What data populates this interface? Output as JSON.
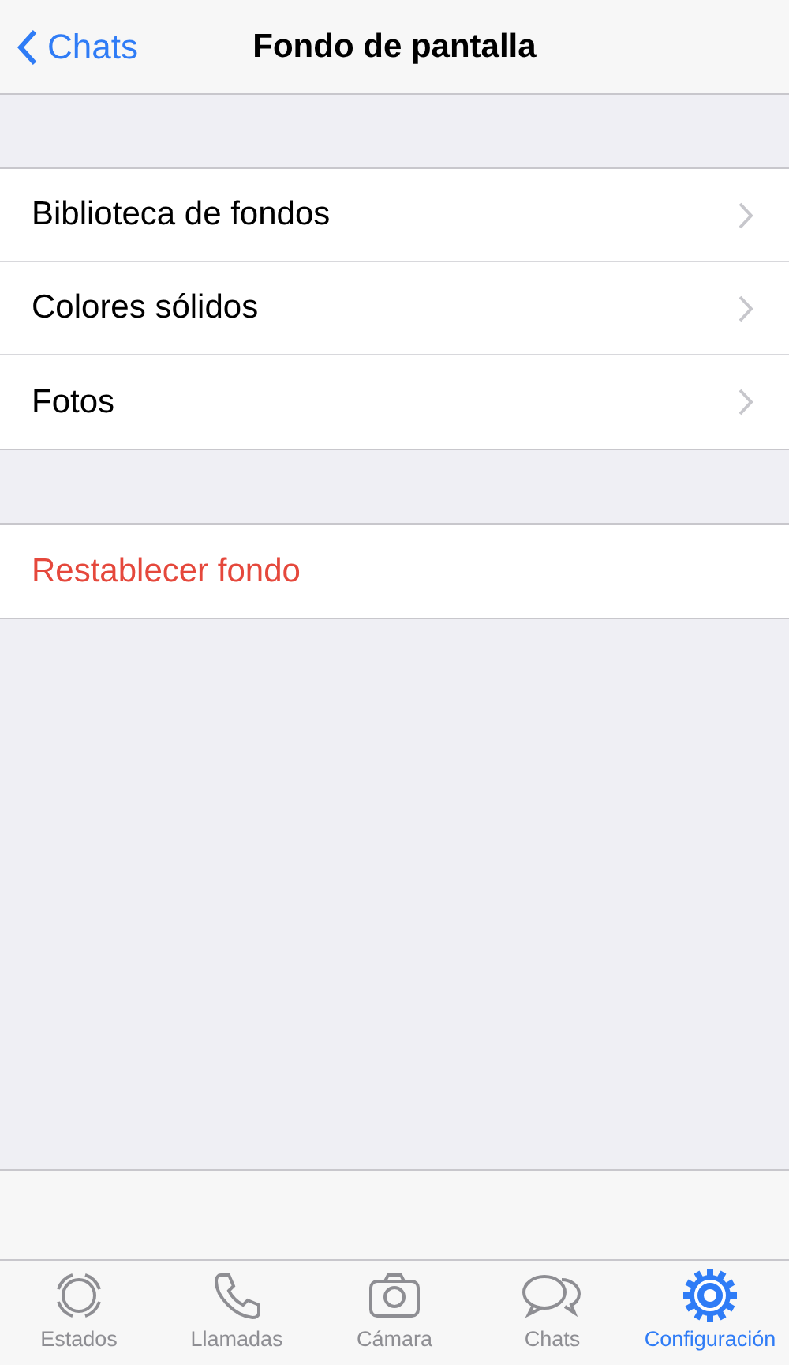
{
  "nav": {
    "back": "Chats",
    "title": "Fondo de pantalla"
  },
  "menu": [
    {
      "label": "Biblioteca de fondos"
    },
    {
      "label": "Colores sólidos"
    },
    {
      "label": "Fotos"
    }
  ],
  "reset": {
    "label": "Restablecer fondo"
  },
  "tabs": [
    {
      "label": "Estados",
      "selected": false
    },
    {
      "label": "Llamadas",
      "selected": false
    },
    {
      "label": "Cámara",
      "selected": false
    },
    {
      "label": "Chats",
      "selected": false
    },
    {
      "label": "Configuración",
      "selected": true
    }
  ]
}
